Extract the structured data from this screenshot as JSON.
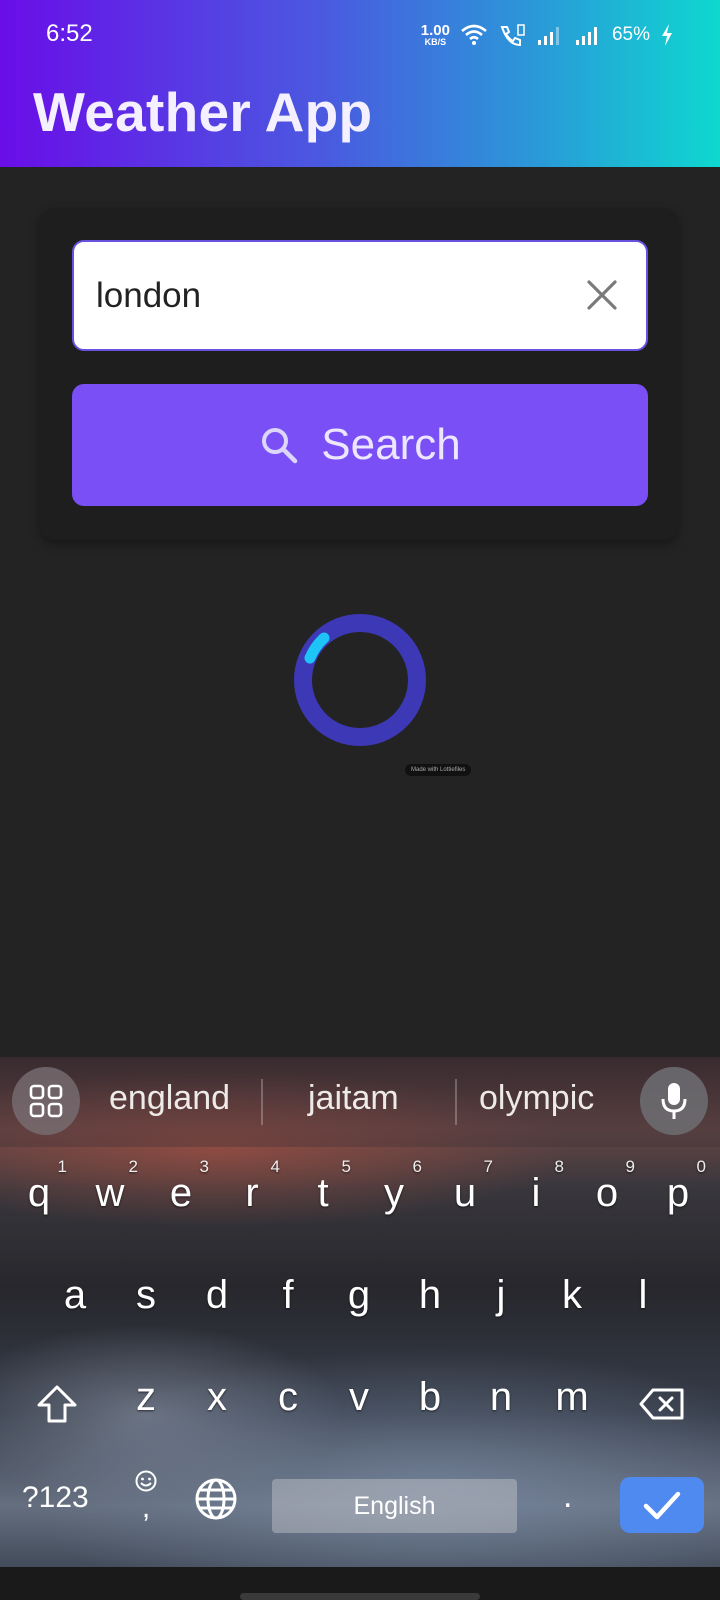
{
  "status_bar": {
    "time": "6:52",
    "net_speed_value": "1.00",
    "net_speed_unit": "KB/S",
    "battery": "65%"
  },
  "app": {
    "title": "Weather App"
  },
  "search": {
    "value": "london",
    "button_label": "Search"
  },
  "loader": {
    "watermark": "Made with Lottiefiles"
  },
  "keyboard": {
    "suggestions": [
      "england",
      "jaitam",
      "olympic"
    ],
    "row1": [
      {
        "ch": "q",
        "num": "1"
      },
      {
        "ch": "w",
        "num": "2"
      },
      {
        "ch": "e",
        "num": "3"
      },
      {
        "ch": "r",
        "num": "4"
      },
      {
        "ch": "t",
        "num": "5"
      },
      {
        "ch": "y",
        "num": "6"
      },
      {
        "ch": "u",
        "num": "7"
      },
      {
        "ch": "i",
        "num": "8"
      },
      {
        "ch": "o",
        "num": "9"
      },
      {
        "ch": "p",
        "num": "0"
      }
    ],
    "row2": [
      "a",
      "s",
      "d",
      "f",
      "g",
      "h",
      "j",
      "k",
      "l"
    ],
    "row3": [
      "z",
      "x",
      "c",
      "v",
      "b",
      "n",
      "m"
    ],
    "symbols_label": "?123",
    "comma": ",",
    "space_label": "English",
    "period": "."
  },
  "colors": {
    "accent": "#7b4ff6",
    "header_gradient_start": "#6a0de8",
    "header_gradient_end": "#0ed8d0",
    "enter_key": "#4f8af0"
  },
  "icons": {
    "clear": "close-icon",
    "search": "search-icon",
    "grid": "grid-icon",
    "mic": "microphone-icon",
    "shift": "shift-icon",
    "backspace": "backspace-icon",
    "emoji": "emoji-icon",
    "globe": "globe-icon",
    "enter": "checkmark-icon"
  }
}
